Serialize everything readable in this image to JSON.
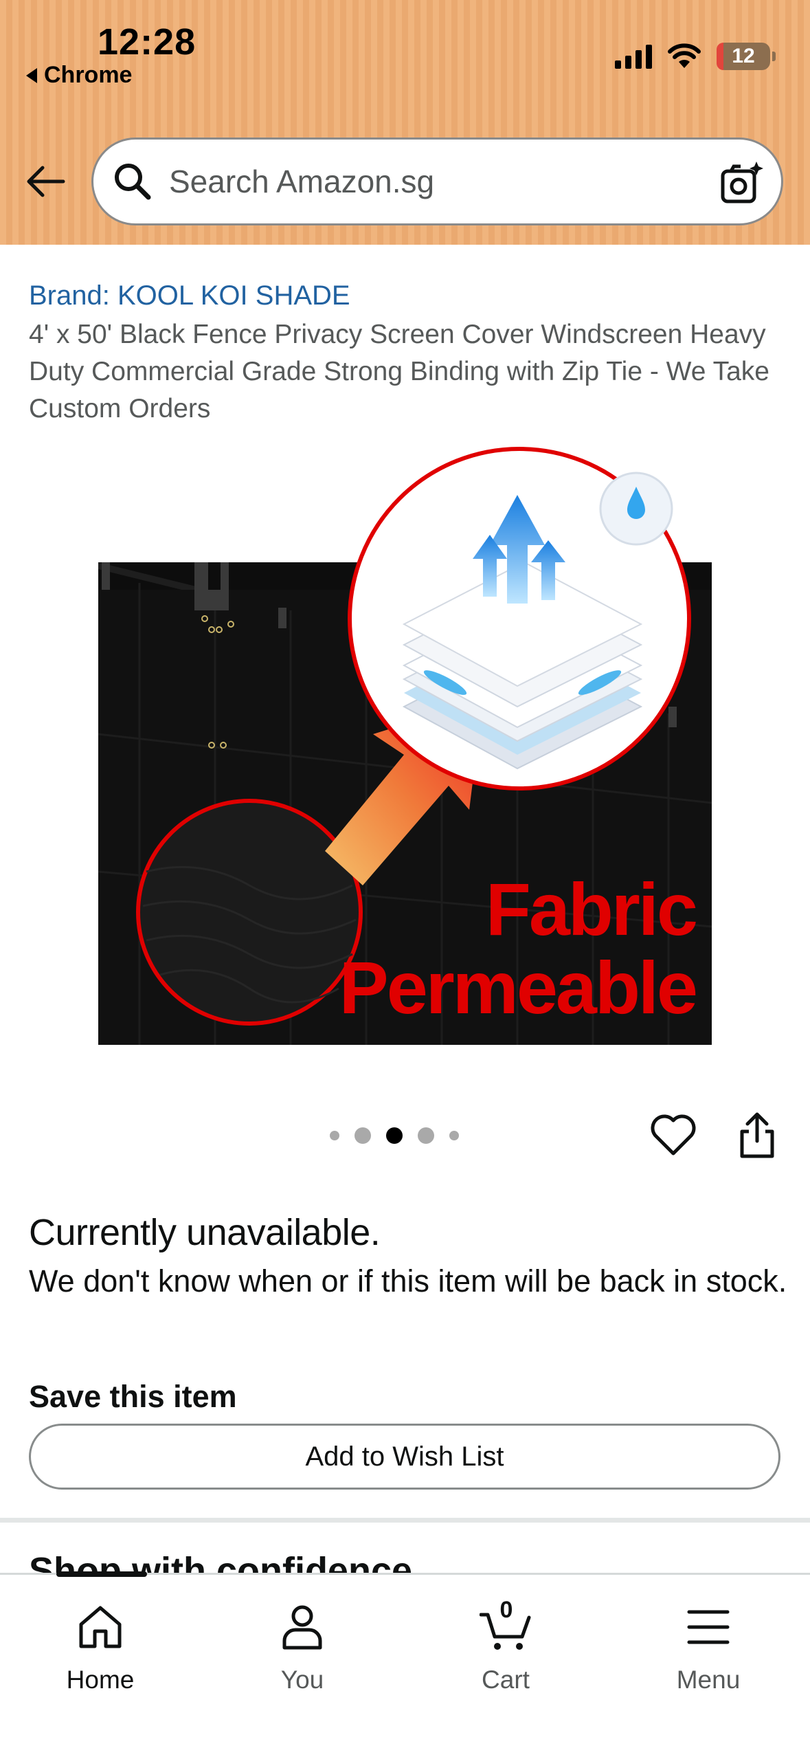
{
  "status_bar": {
    "time": "12:28",
    "back_app": "Chrome",
    "battery": "12"
  },
  "search": {
    "placeholder": "Search Amazon.sg"
  },
  "product": {
    "brand": "Brand: KOOL KOI SHADE",
    "title": "4' x 50' Black Fence Privacy Screen Cover Windscreen Heavy Duty Commercial Grade Strong Binding with Zip Tie - We Take Custom Orders",
    "image_caption_line1": "Fabric",
    "image_caption_line2": "Permeable",
    "image_index": 3,
    "image_count": 5
  },
  "availability": {
    "title": "Currently unavailable.",
    "message": "We don't know when or if this item will be back in stock."
  },
  "save": {
    "title": "Save this item",
    "wish_list_button": "Add to Wish List"
  },
  "next_section": {
    "title": "Shop with confidence"
  },
  "bottom_nav": {
    "home": "Home",
    "you": "You",
    "cart": "Cart",
    "cart_count": "0",
    "menu": "Menu"
  },
  "colors": {
    "header_bg": "#eeb07a",
    "link_blue": "#2162a1",
    "caption_red": "#e00000"
  }
}
